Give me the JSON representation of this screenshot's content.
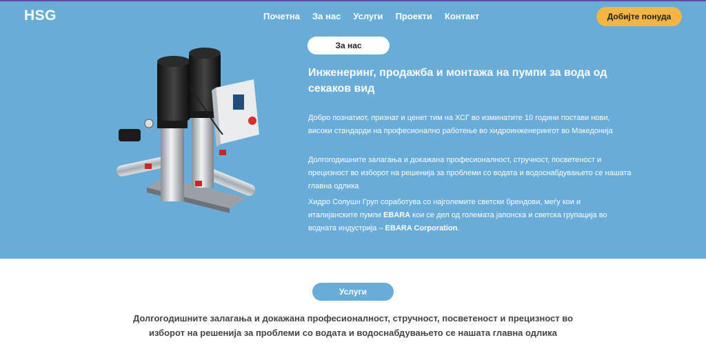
{
  "header": {
    "logo": "HSG",
    "nav": [
      "Почетна",
      "За нас",
      "Услуги",
      "Проекти",
      "Контакт"
    ],
    "cta_label": "Добијте понуда"
  },
  "about": {
    "pill_label": "За нас",
    "title": "Инженеринг, продажба и монтажа на пумпи за вода од секаков вид",
    "p1": "Добро познатиот, признат и ценет тим на ХСГ во изминатите 10 години постави нови, високи стандарди на професионално работење во хидроинженерингот во Македонија",
    "p2": "Долгогодишните залагања и докажана професионалност, стручност, посветеност и прецизност во изборот на решенија за проблеми со водата и водоснабдувањето се нашата главна одлика",
    "p3_a": "Хидро Солушн Груп соработува со најголемите светски брендови, меѓу кои и италијанските пумпи ",
    "p3_brand": "EBARA",
    "p3_b": " кои се дел од големата јапонска и светска групација во водната индустрија – ",
    "p3_corp": "EBARA Corporation",
    "p3_end": "."
  },
  "services": {
    "pill_label": "Услуги",
    "text": "Долгогодишните залагања и докажана професионалност, стручност, посветеност и прецизност во изборот на решенија за проблеми со водата и водоснабдувањето се нашата главна одлика"
  },
  "colors": {
    "hero_bg": "#68acd7",
    "cta_bg": "#f4b544",
    "top_border": "#5b4fa3"
  }
}
